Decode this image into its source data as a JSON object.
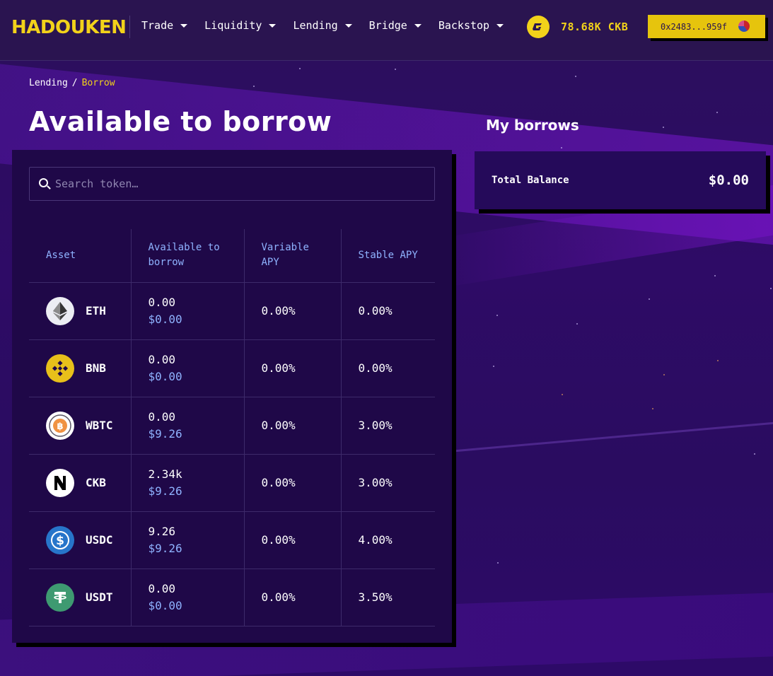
{
  "header": {
    "logo_text": "HADOUKEN",
    "nav": [
      {
        "label": "Trade"
      },
      {
        "label": "Liquidity"
      },
      {
        "label": "Lending"
      },
      {
        "label": "Bridge"
      },
      {
        "label": "Backstop"
      }
    ],
    "balance": "78.68K CKB",
    "wallet_address": "0x2483...959f"
  },
  "breadcrumb": {
    "parent": "Lending",
    "separator": "/",
    "current": "Borrow"
  },
  "main": {
    "title": "Available to borrow",
    "search_placeholder": "Search token…",
    "columns": {
      "asset": "Asset",
      "available": "Available to borrow",
      "variable": "Variable APY",
      "stable": "Stable APY"
    },
    "rows": [
      {
        "symbol": "ETH",
        "icon": "eth-icon",
        "amount": "0.00",
        "usd": "$0.00",
        "variable_apy": "0.00%",
        "stable_apy": "0.00%"
      },
      {
        "symbol": "BNB",
        "icon": "bnb-icon",
        "amount": "0.00",
        "usd": "$0.00",
        "variable_apy": "0.00%",
        "stable_apy": "0.00%"
      },
      {
        "symbol": "WBTC",
        "icon": "wbtc-icon",
        "amount": "0.00",
        "usd": "$9.26",
        "variable_apy": "0.00%",
        "stable_apy": "3.00%"
      },
      {
        "symbol": "CKB",
        "icon": "ckb-icon",
        "amount": "2.34k",
        "usd": "$9.26",
        "variable_apy": "0.00%",
        "stable_apy": "3.00%"
      },
      {
        "symbol": "USDC",
        "icon": "usdc-icon",
        "amount": "9.26",
        "usd": "$9.26",
        "variable_apy": "0.00%",
        "stable_apy": "4.00%"
      },
      {
        "symbol": "USDT",
        "icon": "usdt-icon",
        "amount": "0.00",
        "usd": "$0.00",
        "variable_apy": "0.00%",
        "stable_apy": "3.50%"
      }
    ]
  },
  "side": {
    "title": "My borrows",
    "total_balance_label": "Total Balance",
    "total_balance_value": "$0.00"
  },
  "colors": {
    "accent": "#f2d21a",
    "link_blue": "#8fb3ff",
    "panel": "#1f0848",
    "background": "#2a0e5e"
  }
}
